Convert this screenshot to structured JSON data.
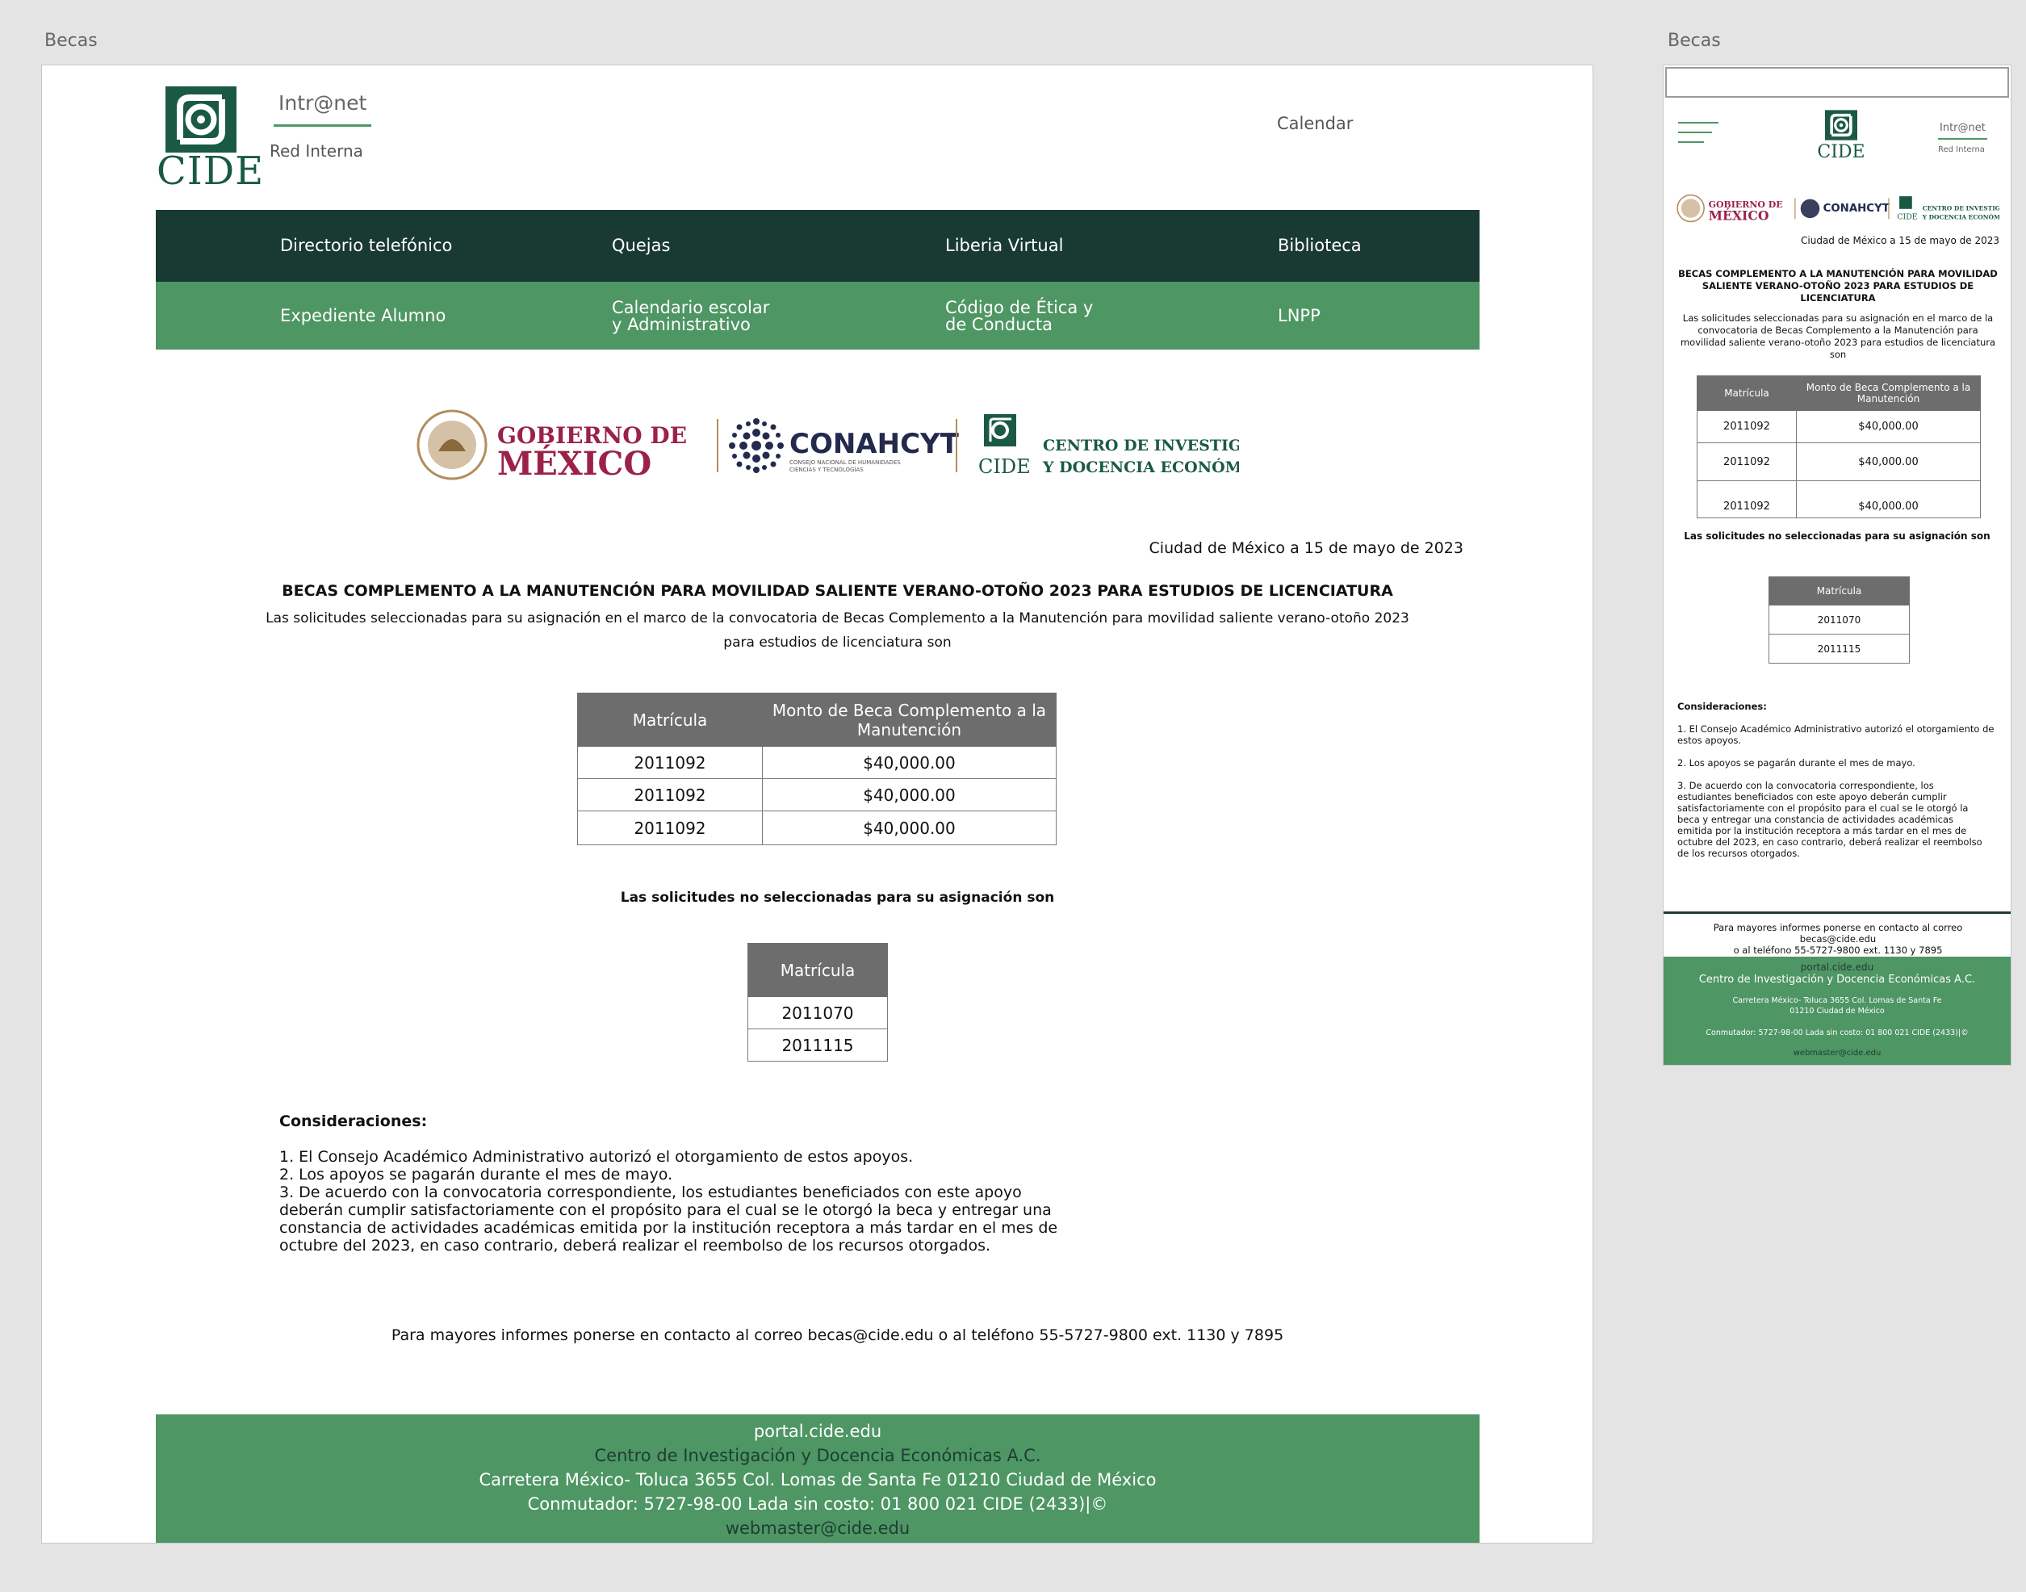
{
  "frame_labels": {
    "desktop": "Becas",
    "mobile": "Becas"
  },
  "header": {
    "logo_text": "CIDE",
    "intranet_label": "Intr@net",
    "red_interna": "Red Interna",
    "calendar_link": "Calendar"
  },
  "nav": {
    "row1": [
      "Directorio telefónico",
      "Quejas",
      "Liberia Virtual",
      "Biblioteca"
    ],
    "row2": [
      {
        "line1": "Expediente Alumno",
        "line2": ""
      },
      {
        "line1": "Calendario escolar",
        "line2": "y Administrativo"
      },
      {
        "line1": "Código de Ética y",
        "line2": "de Conducta"
      },
      {
        "line1": "LNPP",
        "line2": ""
      }
    ]
  },
  "seals": {
    "gob_line1": "GOBIERNO DE",
    "gob_line2": "MÉXICO",
    "conahcyt": "CONAHCYT",
    "conahcyt_sub1": "CONSEJO NACIONAL DE HUMANIDADES",
    "conahcyt_sub2": "CIENCIAS Y TECNOLOGÍAS",
    "cide_small": "CIDE",
    "centro_line1": "CENTRO DE INVESTIGACIÓN",
    "centro_line2": "Y DOCENCIA ECONÓMICAS A.C."
  },
  "content": {
    "date": "Ciudad de México a 15 de mayo de 2023",
    "title": "BECAS COMPLEMENTO A LA MANUTENCIÓN PARA MOVILIDAD SALIENTE VERANO-OTOÑO 2023 PARA ESTUDIOS DE LICENCIATURA",
    "subtitle_line1": "Las solicitudes seleccionadas para su asignación en el marco de la convocatoria de Becas Complemento a la Manutención para movilidad saliente verano-otoño 2023",
    "subtitle_line2": "para estudios de licenciatura son",
    "table_selected": {
      "headers": [
        "Matrícula",
        "Monto de Beca Complemento a la Manutención"
      ],
      "rows": [
        [
          "2011092",
          "$40,000.00"
        ],
        [
          "2011092",
          "$40,000.00"
        ],
        [
          "2011092",
          "$40,000.00"
        ]
      ]
    },
    "not_selected_title": "Las solicitudes no seleccionadas para su asignación son",
    "table_not_selected": {
      "headers": [
        "Matrícula"
      ],
      "rows": [
        [
          "2011070"
        ],
        [
          "2011115"
        ]
      ]
    },
    "considerations_title": "Consideraciones:",
    "considerations": [
      "1. El Consejo Académico Administrativo autorizó el otorgamiento de estos apoyos.",
      "2. Los apoyos se pagarán durante el mes de mayo.",
      "3. De acuerdo con la convocatoria correspondiente, los estudiantes beneficiados con este apoyo deberán cumplir satisfactoriamente con el propósito para el cual se le otorgó la beca y entregar una constancia de actividades académicas emitida por la institución receptora a más tardar en el mes de octubre del 2023, en caso contrario, deberá realizar el reembolso de los recursos otorgados."
    ],
    "contact": "Para mayores informes ponerse en contacto al correo becas@cide.edu o al teléfono 55-5727-9800 ext. 1130 y 7895",
    "contact_m1": "Para mayores informes ponerse en contacto al correo becas@cide.edu",
    "contact_m2": "o al teléfono 55-5727-9800 ext. 1130 y 7895"
  },
  "footer": {
    "portal": "portal.cide.edu",
    "org": "Centro de Investigación y Docencia Económicas A.C.",
    "address": "Carretera México- Toluca 3655 Col. Lomas de Santa Fe 01210 Ciudad de México",
    "address_m1": "Carretera México- Toluca 3655 Col. Lomas de Santa Fe",
    "address_m2": "01210 Ciudad de México",
    "phone": "Conmutador: 5727-98-00 Lada sin costo: 01 800 021 CIDE (2433)|©",
    "email": "webmaster@cide.edu"
  },
  "colors": {
    "dark_green": "#193a33",
    "green": "#4e9663",
    "cide_green": "#1a5a43",
    "gob_red": "#9b2247",
    "gold": "#b38e5d",
    "conahcyt_navy": "#232a4d",
    "table_header": "#6d6d6d"
  },
  "icons": [
    "cide-logo-icon",
    "hamburger-menu-icon",
    "escudo-nacional-icon",
    "conahcyt-dots-icon"
  ]
}
